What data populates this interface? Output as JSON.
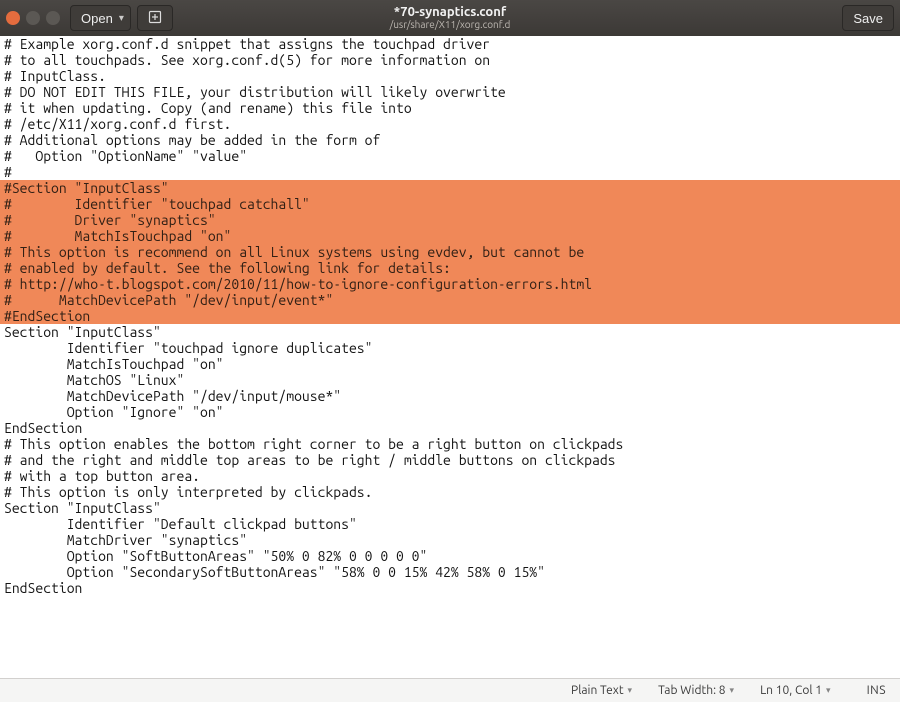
{
  "window": {
    "title_main": "*70-synaptics.conf",
    "title_sub": "/usr/share/X11/xorg.conf.d",
    "open_label": "Open",
    "save_label": "Save"
  },
  "editor": {
    "lines": [
      {
        "t": "# Example xorg.conf.d snippet that assigns the touchpad driver",
        "sel": false
      },
      {
        "t": "# to all touchpads. See xorg.conf.d(5) for more information on",
        "sel": false
      },
      {
        "t": "# InputClass.",
        "sel": false
      },
      {
        "t": "# DO NOT EDIT THIS FILE, your distribution will likely overwrite",
        "sel": false
      },
      {
        "t": "# it when updating. Copy (and rename) this file into",
        "sel": false
      },
      {
        "t": "# /etc/X11/xorg.conf.d first.",
        "sel": false
      },
      {
        "t": "# Additional options may be added in the form of",
        "sel": false
      },
      {
        "t": "#   Option \"OptionName\" \"value\"",
        "sel": false
      },
      {
        "t": "#",
        "sel": false
      },
      {
        "t": "#Section \"InputClass\"",
        "sel": true
      },
      {
        "t": "#        Identifier \"touchpad catchall\"",
        "sel": true
      },
      {
        "t": "#        Driver \"synaptics\"",
        "sel": true
      },
      {
        "t": "#        MatchIsTouchpad \"on\"",
        "sel": true
      },
      {
        "t": "# This option is recommend on all Linux systems using evdev, but cannot be",
        "sel": true
      },
      {
        "t": "# enabled by default. See the following link for details:",
        "sel": true
      },
      {
        "t": "# http://who-t.blogspot.com/2010/11/how-to-ignore-configuration-errors.html",
        "sel": true
      },
      {
        "t": "#      MatchDevicePath \"/dev/input/event*\"",
        "sel": true
      },
      {
        "t": "#EndSection",
        "sel": true
      },
      {
        "t": "",
        "sel": false
      },
      {
        "t": "Section \"InputClass\"",
        "sel": false
      },
      {
        "t": "        Identifier \"touchpad ignore duplicates\"",
        "sel": false
      },
      {
        "t": "        MatchIsTouchpad \"on\"",
        "sel": false
      },
      {
        "t": "        MatchOS \"Linux\"",
        "sel": false
      },
      {
        "t": "        MatchDevicePath \"/dev/input/mouse*\"",
        "sel": false
      },
      {
        "t": "        Option \"Ignore\" \"on\"",
        "sel": false
      },
      {
        "t": "EndSection",
        "sel": false
      },
      {
        "t": "",
        "sel": false
      },
      {
        "t": "# This option enables the bottom right corner to be a right button on clickpads",
        "sel": false
      },
      {
        "t": "# and the right and middle top areas to be right / middle buttons on clickpads",
        "sel": false
      },
      {
        "t": "# with a top button area.",
        "sel": false
      },
      {
        "t": "# This option is only interpreted by clickpads.",
        "sel": false
      },
      {
        "t": "Section \"InputClass\"",
        "sel": false
      },
      {
        "t": "        Identifier \"Default clickpad buttons\"",
        "sel": false
      },
      {
        "t": "        MatchDriver \"synaptics\"",
        "sel": false
      },
      {
        "t": "        Option \"SoftButtonAreas\" \"50% 0 82% 0 0 0 0 0\"",
        "sel": false
      },
      {
        "t": "        Option \"SecondarySoftButtonAreas\" \"58% 0 0 15% 42% 58% 0 15%\"",
        "sel": false
      },
      {
        "t": "EndSection",
        "sel": false
      }
    ]
  },
  "status": {
    "syntax": "Plain Text",
    "tabwidth": "Tab Width: 8",
    "position": "Ln 10, Col 1",
    "mode": "INS"
  }
}
